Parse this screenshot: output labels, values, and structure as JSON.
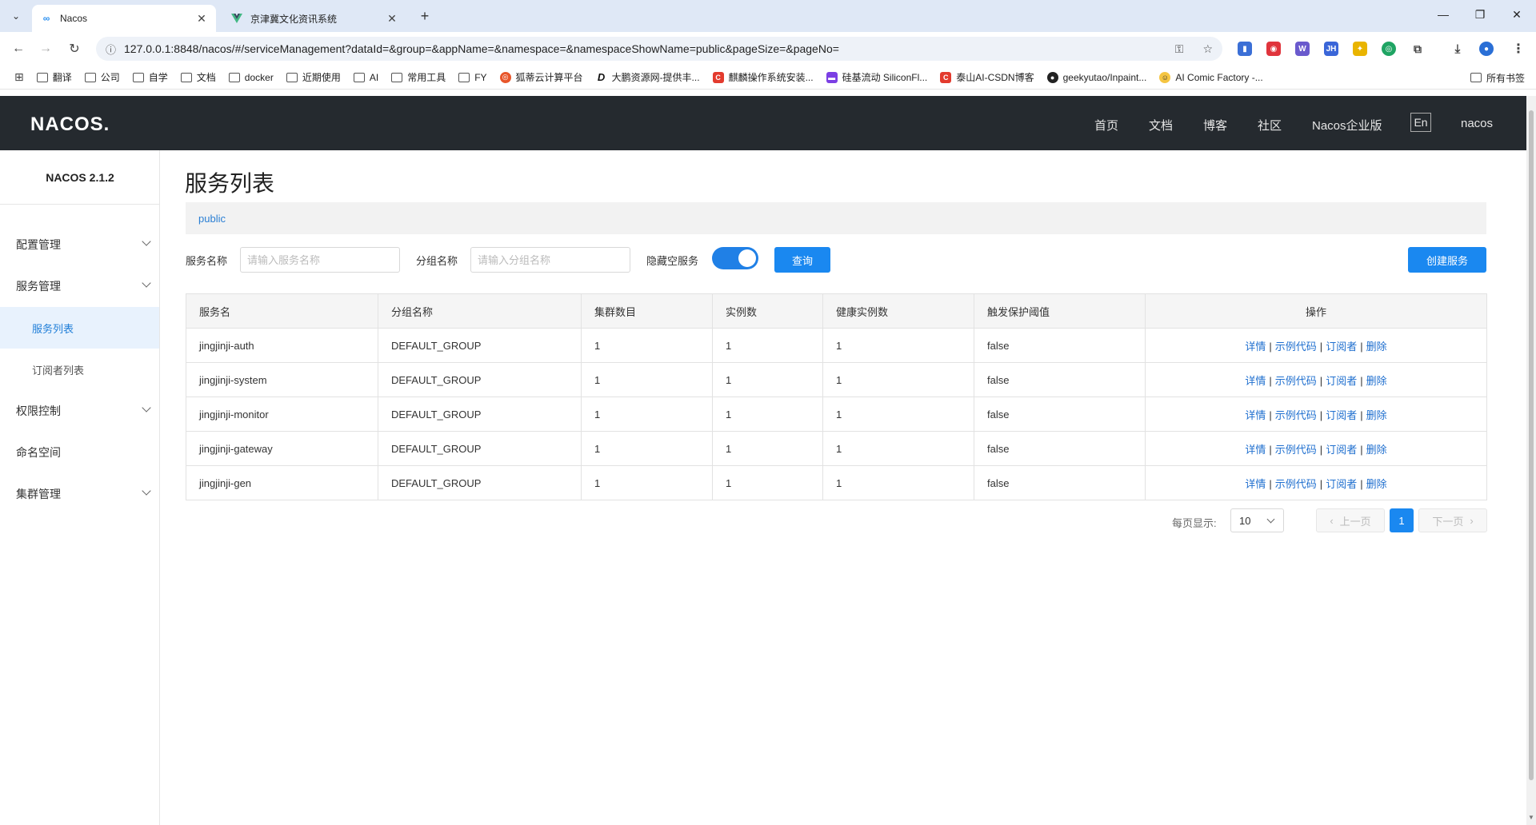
{
  "browser": {
    "tabs": [
      {
        "title": "Nacos",
        "favicon": "infinity-icon"
      },
      {
        "title": "京津冀文化资讯系统",
        "favicon": "vue-icon"
      }
    ],
    "url": "127.0.0.1:8848/nacos/#/serviceManagement?dataId=&group=&appName=&namespace=&namespaceShowName=public&pageSize=&pageNo=",
    "bookmarks": [
      "翻译",
      "公司",
      "自学",
      "文档",
      "docker",
      "近期使用",
      "AI",
      "常用工具",
      "FY"
    ],
    "bookmark_sites": [
      "狐蒂云计算平台",
      "大鹏资源网-提供丰...",
      "麒麟操作系统安装...",
      "硅基流动 SiliconFl...",
      "泰山AI-CSDN博客",
      "geekyutao/Inpaint...",
      "AI Comic Factory -..."
    ],
    "all_bookmarks": "所有书签"
  },
  "header": {
    "logo": "NACOS.",
    "nav": [
      "首页",
      "文档",
      "博客",
      "社区",
      "Nacos企业版"
    ],
    "lang": "En",
    "user": "nacos"
  },
  "sidebar": {
    "version": "NACOS 2.1.2",
    "items": [
      {
        "label": "配置管理"
      },
      {
        "label": "服务管理"
      },
      {
        "label": "服务列表"
      },
      {
        "label": "订阅者列表"
      },
      {
        "label": "权限控制"
      },
      {
        "label": "命名空间"
      },
      {
        "label": "集群管理"
      }
    ]
  },
  "main": {
    "title": "服务列表",
    "namespace": "public",
    "filters": {
      "service_label": "服务名称",
      "service_placeholder": "请输入服务名称",
      "group_label": "分组名称",
      "group_placeholder": "请输入分组名称",
      "hide_empty_label": "隐藏空服务",
      "hide_empty_on": true,
      "query_button": "查询",
      "create_button": "创建服务"
    },
    "table": {
      "headers": [
        "服务名",
        "分组名称",
        "集群数目",
        "实例数",
        "健康实例数",
        "触发保护阈值",
        "操作"
      ],
      "rows": [
        [
          "jingjinji-auth",
          "DEFAULT_GROUP",
          "1",
          "1",
          "1",
          "false"
        ],
        [
          "jingjinji-system",
          "DEFAULT_GROUP",
          "1",
          "1",
          "1",
          "false"
        ],
        [
          "jingjinji-monitor",
          "DEFAULT_GROUP",
          "1",
          "1",
          "1",
          "false"
        ],
        [
          "jingjinji-gateway",
          "DEFAULT_GROUP",
          "1",
          "1",
          "1",
          "false"
        ],
        [
          "jingjinji-gen",
          "DEFAULT_GROUP",
          "1",
          "1",
          "1",
          "false"
        ]
      ],
      "ops": [
        "详情",
        "示例代码",
        "订阅者",
        "删除"
      ]
    },
    "pager": {
      "per_page_label": "每页显示:",
      "per_page": "10",
      "prev": "上一页",
      "current": "1",
      "next": "下一页"
    }
  },
  "colors": {
    "header_bg": "#252a2f",
    "accent": "#1a88f0",
    "link": "#1f6fcf",
    "active_menu_bg": "#e8f2fd"
  }
}
